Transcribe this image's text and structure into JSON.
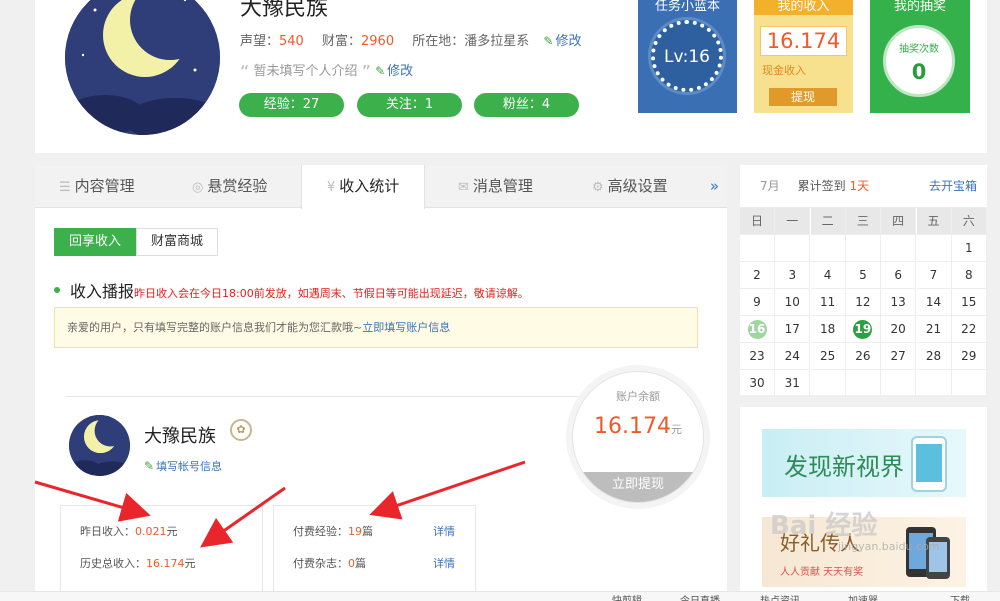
{
  "profile": {
    "name": "大豫民族",
    "reputation_label": "声望：",
    "reputation": "540",
    "wealth_label": "财富：",
    "wealth": "2960",
    "location_label": "所在地：",
    "location": "潘多拉星系",
    "edit": "修改",
    "bio": "暂未填写个人介绍",
    "bio_edit": "修改",
    "experience": "经验：27",
    "following": "关注：1",
    "fans": "粉丝：4"
  },
  "tiles": {
    "task_title": "任务小蓝本",
    "task_level": "Lv:16",
    "income_title": "我的收入",
    "income_value": "16.174",
    "income_label": "现金收入",
    "withdraw": "提现",
    "lottery_title": "我的抽奖",
    "lottery_label": "抽奖次数",
    "lottery_count": "0"
  },
  "tabs": {
    "content": "内容管理",
    "reward": "悬赏经验",
    "income": "收入统计",
    "message": "消息管理",
    "advanced": "高级设置",
    "more": "»"
  },
  "subtabs": {
    "share_income": "回享收入",
    "wealth_mall": "财富商城"
  },
  "income_section": {
    "title": "收入播报",
    "notice": "昨日收入会在今日18:00前发放，如遇周末、节假日等可能出现延迟，敬请谅解。",
    "info": "亲爱的用户，只有填写完整的账户信息我们才能为您汇款哦~",
    "info_link": "立即填写账户信息"
  },
  "account": {
    "name": "大豫民族",
    "fill_info": "填写帐号信息",
    "balance_label": "账户余额",
    "balance": "16.174",
    "balance_unit": "元",
    "withdraw_now": "立即提现"
  },
  "stats": {
    "yesterday_label": "昨日收入：",
    "yesterday": "0.021",
    "yesterday_unit": "元",
    "total_label": "历史总收入：",
    "total": "16.174",
    "total_unit": "元",
    "paid_exp_label": "付费经验：",
    "paid_exp": "19",
    "paid_exp_unit": "篇",
    "paid_mag_label": "付费杂志：",
    "paid_mag": "0",
    "paid_mag_unit": "篇",
    "detail": "详情"
  },
  "calendar": {
    "month": "7月",
    "checkin_label": "累计签到",
    "checkin_days": "1天",
    "open_box": "去开宝箱",
    "weekdays": [
      "日",
      "一",
      "二",
      "三",
      "四",
      "五",
      "六"
    ],
    "days": [
      "1",
      "2",
      "3",
      "4",
      "5",
      "6",
      "7",
      "8",
      "9",
      "10",
      "11",
      "12",
      "13",
      "14",
      "15",
      "16",
      "17",
      "18",
      "19",
      "20",
      "21",
      "22",
      "23",
      "24",
      "25",
      "26",
      "27",
      "28",
      "29",
      "30",
      "31"
    ],
    "first_weekday": 6,
    "marked_light": "16",
    "marked_dark": "19"
  },
  "ads": {
    "ad1_text": "发现新视界",
    "ad2_text": "好礼传人",
    "ad2_sub": "人人贡献  天天有奖"
  },
  "watermark": {
    "text": "Bai 经验",
    "sub": "jingyan.baidu.com"
  },
  "bottom_bar": {
    "items": [
      "快剪辑",
      "今日直播",
      "热点资讯",
      "加速器",
      "下载"
    ]
  },
  "colors": {
    "green": "#3cb04a",
    "orange": "#f05a28",
    "blue_link": "#3b73b9",
    "arrow_red": "#e8262b"
  }
}
